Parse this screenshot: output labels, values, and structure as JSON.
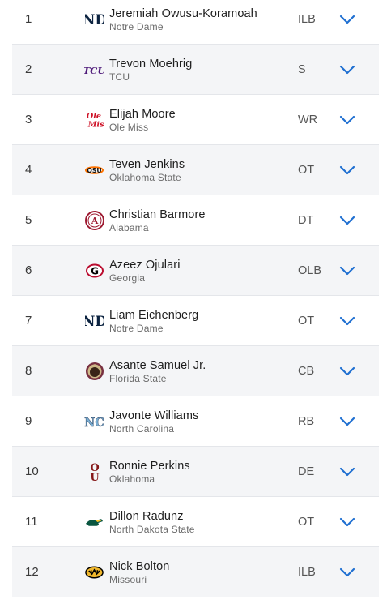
{
  "colors": {
    "chevron": "#1f6fd1",
    "row_alt_bg": "#f4f5f7",
    "divider": "#e4e6ea"
  },
  "picks": [
    {
      "rank": "1",
      "name": "Jeremiah Owusu-Koramoah",
      "school": "Notre Dame",
      "position": "ILB",
      "logo": "notre-dame-logo"
    },
    {
      "rank": "2",
      "name": "Trevon Moehrig",
      "school": "TCU",
      "position": "S",
      "logo": "tcu-logo"
    },
    {
      "rank": "3",
      "name": "Elijah Moore",
      "school": "Ole Miss",
      "position": "WR",
      "logo": "ole-miss-logo"
    },
    {
      "rank": "4",
      "name": "Teven Jenkins",
      "school": "Oklahoma State",
      "position": "OT",
      "logo": "oklahoma-state-logo"
    },
    {
      "rank": "5",
      "name": "Christian Barmore",
      "school": "Alabama",
      "position": "DT",
      "logo": "alabama-logo"
    },
    {
      "rank": "6",
      "name": "Azeez Ojulari",
      "school": "Georgia",
      "position": "OLB",
      "logo": "georgia-logo"
    },
    {
      "rank": "7",
      "name": "Liam Eichenberg",
      "school": "Notre Dame",
      "position": "OT",
      "logo": "notre-dame-logo"
    },
    {
      "rank": "8",
      "name": "Asante Samuel Jr.",
      "school": "Florida State",
      "position": "CB",
      "logo": "florida-state-logo"
    },
    {
      "rank": "9",
      "name": "Javonte Williams",
      "school": "North Carolina",
      "position": "RB",
      "logo": "north-carolina-logo"
    },
    {
      "rank": "10",
      "name": "Ronnie Perkins",
      "school": "Oklahoma",
      "position": "DE",
      "logo": "oklahoma-logo"
    },
    {
      "rank": "11",
      "name": "Dillon Radunz",
      "school": "North Dakota State",
      "position": "OT",
      "logo": "north-dakota-state-logo"
    },
    {
      "rank": "12",
      "name": "Nick Bolton",
      "school": "Missouri",
      "position": "ILB",
      "logo": "missouri-logo"
    }
  ]
}
